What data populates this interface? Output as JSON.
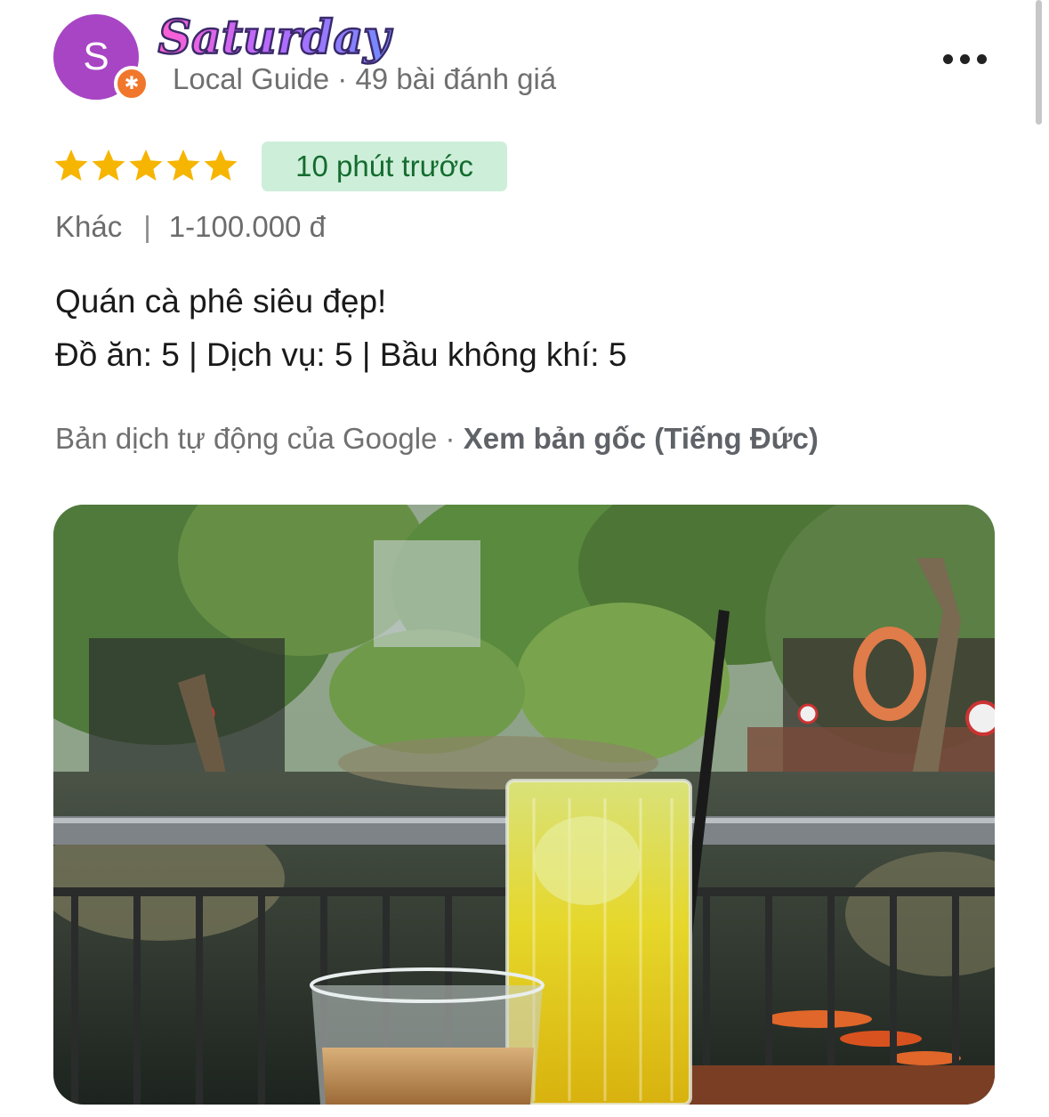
{
  "reviewer": {
    "avatar_initial": "S",
    "name_sticker_text": "Saturday",
    "subline": "Local Guide · 49 bài đánh giá"
  },
  "review": {
    "rating": 5,
    "max_rating": 5,
    "time_badge": "10 phút trước",
    "category": "Khác",
    "separator": "|",
    "price_range": "1-100.000 đ",
    "text_line1": "Quán cà phê siêu đẹp!",
    "text_line2": "Đồ ăn: 5 | Dịch vụ: 5 | Bầu không khí: 5",
    "translation_note": "Bản dịch tự động của Google · ",
    "see_original": "Xem bản gốc (Tiếng Đức)"
  },
  "colors": {
    "avatar_bg": "#a845c4",
    "badge_bg": "#f1772c",
    "star": "#f6b500",
    "time_badge_bg": "#cdeed9",
    "time_badge_text": "#146c2e"
  },
  "icons": {
    "more": "more-horizontal-icon",
    "star": "star-icon",
    "local_guide": "local-guide-star-icon"
  }
}
